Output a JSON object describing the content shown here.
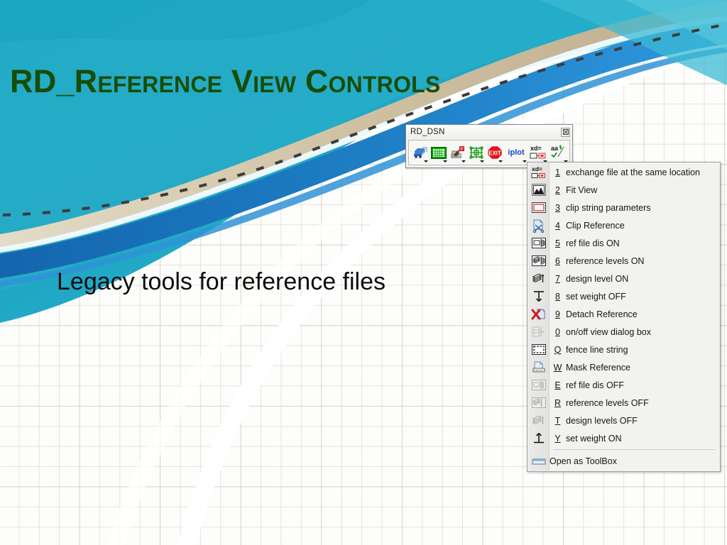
{
  "slide": {
    "title": "RD_Reference View Controls",
    "body_text": "Legacy tools for reference files",
    "title_color": "#174d08",
    "body_color": "#0d0d0d",
    "background_color": "#fdfdfb",
    "ribbon_colors": [
      "#17a9c4",
      "#1e7fc4",
      "#cdbfa1",
      "#ffffff",
      "#2aa8c9"
    ]
  },
  "toolbar_window": {
    "title": "RD_DSN",
    "close_button": "close-icon",
    "buttons": [
      {
        "name": "blue-vehicle-icon",
        "label": "",
        "has_caret": true
      },
      {
        "name": "green-grid-icon",
        "label": "",
        "has_caret": true
      },
      {
        "name": "hammer-stamp-icon",
        "label": "",
        "has_caret": true
      },
      {
        "name": "green-crosshair-icon",
        "label": "",
        "has_caret": true
      },
      {
        "name": "exit-stop-icon",
        "label": "EXIT",
        "has_caret": true
      },
      {
        "name": "iplot-icon",
        "label": "iplot",
        "has_caret": true
      },
      {
        "name": "exchange-xd-icon",
        "label": "xd=",
        "has_caret": true
      },
      {
        "name": "text-aa-icon",
        "label": "aa",
        "has_caret": true
      }
    ]
  },
  "menu": {
    "items": [
      {
        "accel": "1",
        "label": "exchange file at the same location",
        "icon": "exchange-file-icon",
        "dim": false
      },
      {
        "accel": "2",
        "label": "Fit View",
        "icon": "fit-view-icon",
        "dim": false
      },
      {
        "accel": "3",
        "label": "clip string parameters",
        "icon": "clip-string-icon",
        "dim": false
      },
      {
        "accel": "4",
        "label": "Clip Reference",
        "icon": "clip-reference-scissors-icon",
        "dim": false
      },
      {
        "accel": "5",
        "label": "ref file dis ON",
        "icon": "ref-file-display-on-icon",
        "dim": false
      },
      {
        "accel": "6",
        "label": "reference levels ON",
        "icon": "reference-levels-on-icon",
        "dim": false
      },
      {
        "accel": "7",
        "label": "design level ON",
        "icon": "design-level-on-icon",
        "dim": false
      },
      {
        "accel": "8",
        "label": "set weight OFF",
        "icon": "set-weight-off-icon",
        "dim": false
      },
      {
        "accel": "9",
        "label": "Detach Reference",
        "icon": "detach-reference-icon",
        "dim": false
      },
      {
        "accel": "0",
        "label": "on/off view dialog box",
        "icon": "view-dialog-box-icon",
        "dim": true
      },
      {
        "accel": "Q",
        "label": "fence line string",
        "icon": "fence-line-string-icon",
        "dim": false
      },
      {
        "accel": "W",
        "label": "Mask Reference",
        "icon": "mask-reference-icon",
        "dim": false
      },
      {
        "accel": "E",
        "label": "ref file dis OFF",
        "icon": "ref-file-display-off-icon",
        "dim": true
      },
      {
        "accel": "R",
        "label": "reference levels OFF",
        "icon": "reference-levels-off-icon",
        "dim": true
      },
      {
        "accel": "T",
        "label": "design levels OFF",
        "icon": "design-levels-off-icon",
        "dim": true
      },
      {
        "accel": "Y",
        "label": "set weight ON",
        "icon": "set-weight-on-icon",
        "dim": false
      }
    ],
    "footer": {
      "label": "Open as ToolBox",
      "icon": "open-as-toolbox-icon"
    }
  }
}
